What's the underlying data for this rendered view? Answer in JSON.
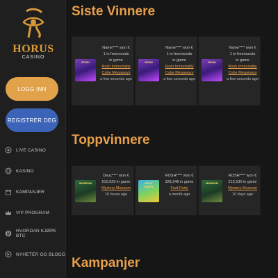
{
  "sidebar": {
    "logo": {
      "word": "HORUS",
      "sub": "CASINO"
    },
    "login_label": "LOGG INN",
    "register_label": "REGISTRER DEG",
    "menu": [
      {
        "label": "LIVE CASINO",
        "icon": "live-icon"
      },
      {
        "label": "KASINO",
        "icon": "casino-chip-icon"
      },
      {
        "label": "KAMPANJER",
        "icon": "gift-icon"
      },
      {
        "label": "VIP PROGRAM",
        "icon": "crown-icon"
      },
      {
        "label": "HVORDAN KJØPE BTC",
        "icon": "bitcoin-icon"
      },
      {
        "label": "NYHETER OG BLOGG",
        "icon": "news-icon"
      }
    ]
  },
  "sections": {
    "latest_title": "Siste Vinnere",
    "top_title": "Toppvinnere",
    "promo_title": "Kampanjer"
  },
  "latest": [
    {
      "line1": "Name**** won €",
      "line2": "1 in freerounds",
      "line3": "in game",
      "game": "Rosh Immortality Cube Megaways",
      "tail": "a few seconds ago",
      "thumb_text": "ROSH"
    },
    {
      "line1": "Name**** won €",
      "line2": "1 in freerounds",
      "line3": "in game",
      "game": "Rosh Immortality Cube Megaways",
      "tail": "a few seconds ago",
      "thumb_text": "ROSH"
    },
    {
      "line1": "Name**** won €",
      "line2": "1 in freerounds",
      "line3": "in game",
      "game": "Rosh Immortality Cube Megaways",
      "tail": "a few seconds ago",
      "thumb_text": "ROSH"
    }
  ],
  "top": [
    {
      "line1": "Deuc**** won €",
      "line2": "510,020 in game",
      "game": "Mystery Museum",
      "tail": "16 hours ago",
      "thumb_text": "MUSEUM"
    },
    {
      "line1": "ROSH**** won €",
      "line2": "328,348 in game",
      "game": "Fruit Party",
      "tail": "a month ago",
      "thumb_text": "FRUIT PARTY"
    },
    {
      "line1": "ROSH**** won €",
      "line2": "215,530 in game",
      "game": "Mystery Museum",
      "tail": "10 days ago",
      "thumb_text": "MUSEUM"
    }
  ],
  "colors": {
    "accent": "#e9a04a",
    "login": "#e2a24a",
    "register": "#3b63b8",
    "bg": "#161616",
    "sidebar": "#1f1f1f",
    "card": "#262626"
  }
}
